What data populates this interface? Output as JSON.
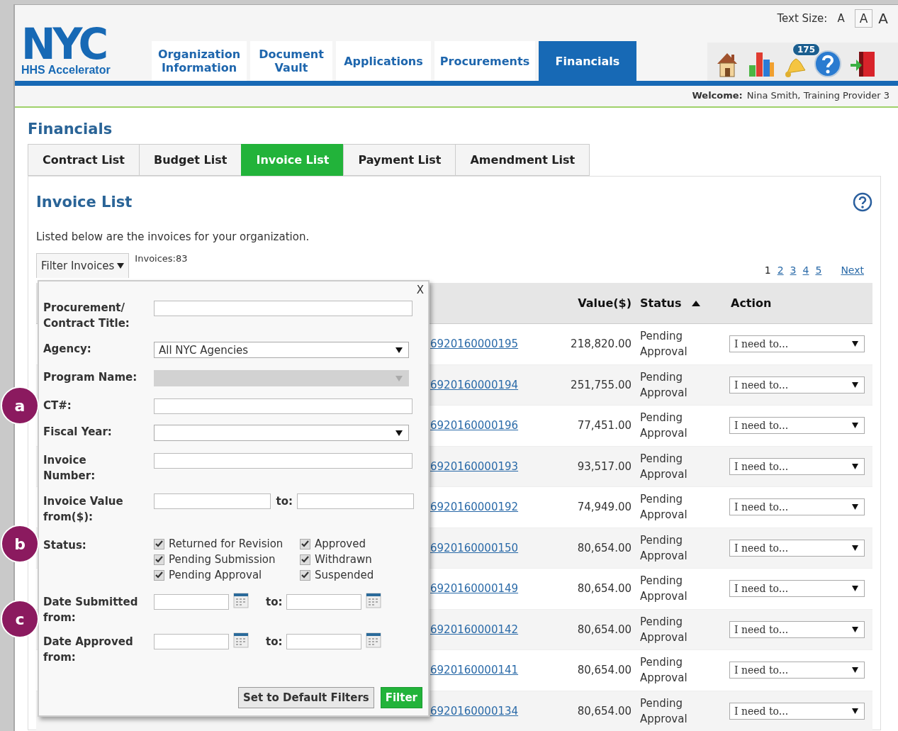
{
  "header": {
    "logo": "NYC",
    "logo_subtitle": "HHS Accelerator",
    "text_size": {
      "label": "Text Size:",
      "options": [
        {
          "label": "A",
          "selected": false
        },
        {
          "label": "A",
          "selected": true
        },
        {
          "label": "A",
          "selected": false
        }
      ]
    },
    "nav": [
      {
        "label": "Organization Information",
        "selected": false
      },
      {
        "label": "Document Vault",
        "selected": false
      },
      {
        "label": "Applications",
        "selected": false
      },
      {
        "label": "Procurements",
        "selected": false
      },
      {
        "label": "Financials",
        "selected": true
      }
    ],
    "notifications_badge": "175",
    "welcome_label": "Welcome:",
    "welcome_user": "Nina Smith, Training Provider 3"
  },
  "page_title": "Financials",
  "tabs": [
    {
      "label": "Contract List",
      "selected": false
    },
    {
      "label": "Budget List",
      "selected": false
    },
    {
      "label": "Invoice List",
      "selected": true
    },
    {
      "label": "Payment List",
      "selected": false
    },
    {
      "label": "Amendment List",
      "selected": false
    }
  ],
  "panel": {
    "title": "Invoice List",
    "description": "Listed below are the invoices for your organization.",
    "filter_button": "Filter Invoices",
    "count": "Invoices:83",
    "pagination": [
      {
        "label": "1",
        "selected": true
      },
      {
        "label": "2",
        "selected": false
      },
      {
        "label": "3",
        "selected": false
      },
      {
        "label": "4",
        "selected": false
      },
      {
        "label": "5",
        "selected": false
      },
      {
        "label": "Next",
        "selected": false
      }
    ],
    "table": {
      "columns": [
        {
          "label": "Value($)",
          "sort_ascending": false
        },
        {
          "label": "Status",
          "sort_ascending": true
        },
        {
          "label": "Action",
          "sort_ascending": false
        }
      ],
      "rows": [
        {
          "invoice": "6920160000195",
          "value": "218,820.00",
          "status": "Pending Approval",
          "action": "I need to..."
        },
        {
          "invoice": "6920160000194",
          "value": "251,755.00",
          "status": "Pending Approval",
          "action": "I need to..."
        },
        {
          "invoice": "6920160000196",
          "value": "77,451.00",
          "status": "Pending Approval",
          "action": "I need to..."
        },
        {
          "invoice": "6920160000193",
          "value": "93,517.00",
          "status": "Pending Approval",
          "action": "I need to..."
        },
        {
          "invoice": "6920160000192",
          "value": "74,949.00",
          "status": "Pending Approval",
          "action": "I need to..."
        },
        {
          "invoice": "6920160000150",
          "value": "80,654.00",
          "status": "Pending Approval",
          "action": "I need to..."
        },
        {
          "invoice": "6920160000149",
          "value": "80,654.00",
          "status": "Pending Approval",
          "action": "I need to..."
        },
        {
          "invoice": "6920160000142",
          "value": "80,654.00",
          "status": "Pending Approval",
          "action": "I need to..."
        },
        {
          "invoice": "6920160000141",
          "value": "80,654.00",
          "status": "Pending Approval",
          "action": "I need to..."
        },
        {
          "invoice": "6920160000134",
          "value": "80,654.00",
          "status": "Pending Approval",
          "action": "I need to..."
        }
      ]
    }
  },
  "filter_popup": {
    "close": "X",
    "fields": [
      {
        "kind": "text",
        "label": "Procurement/ Contract Title:"
      },
      {
        "kind": "select",
        "label": "Agency:",
        "value": "All NYC Agencies"
      },
      {
        "kind": "disabled-select",
        "label": "Program Name:"
      },
      {
        "kind": "text",
        "label": "CT#:"
      },
      {
        "kind": "select",
        "label": "Fiscal Year:"
      },
      {
        "kind": "text",
        "label": "Invoice Number:"
      },
      {
        "kind": "range",
        "label": "Invoice Value from($):",
        "to_label": "to:"
      },
      {
        "kind": "checkboxes",
        "label": "Status:",
        "options": [
          {
            "label": "Returned for Revision",
            "checked": true
          },
          {
            "label": "Approved",
            "checked": true
          },
          {
            "label": "Pending Submission",
            "checked": true
          },
          {
            "label": "Withdrawn",
            "checked": true
          },
          {
            "label": "Pending Approval",
            "checked": true
          },
          {
            "label": "Suspended",
            "checked": true
          }
        ]
      },
      {
        "kind": "date-range",
        "label": "Date Submitted from:",
        "to_label": "to:"
      },
      {
        "kind": "date-range",
        "label": "Date Approved from:",
        "to_label": "to:"
      }
    ],
    "buttons": [
      {
        "label": "Set to Default Filters",
        "kind": "secondary"
      },
      {
        "label": "Filter",
        "kind": "primary"
      }
    ]
  },
  "callouts": [
    {
      "label": "a"
    },
    {
      "label": "b"
    },
    {
      "label": "c"
    }
  ]
}
